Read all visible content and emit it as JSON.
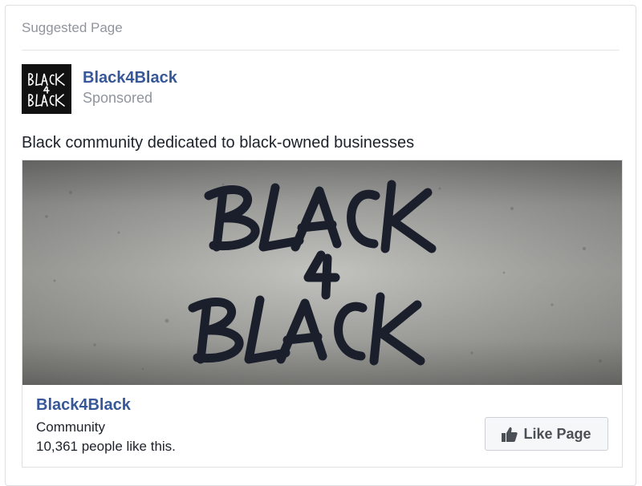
{
  "card": {
    "header": "Suggested Page"
  },
  "post": {
    "author": "Black4Black",
    "subtitle": "Sponsored",
    "text": "Black community dedicated to black-owned businesses"
  },
  "avatar": {
    "logo_text_top": "BLACK",
    "logo_text_mid": "4",
    "logo_text_bottom": "BLACK"
  },
  "cover": {
    "logo_text_top": "BLACK",
    "logo_text_mid": "4",
    "logo_text_bottom": "BLACK"
  },
  "page": {
    "name": "Black4Black",
    "category": "Community",
    "likes": "10,361 people like this.",
    "like_button_label": "Like Page"
  },
  "colors": {
    "link_blue": "#365899",
    "muted_gray": "#90949c",
    "button_bg": "#f6f7f9"
  },
  "icons": {
    "like": "thumbs-up-icon"
  }
}
